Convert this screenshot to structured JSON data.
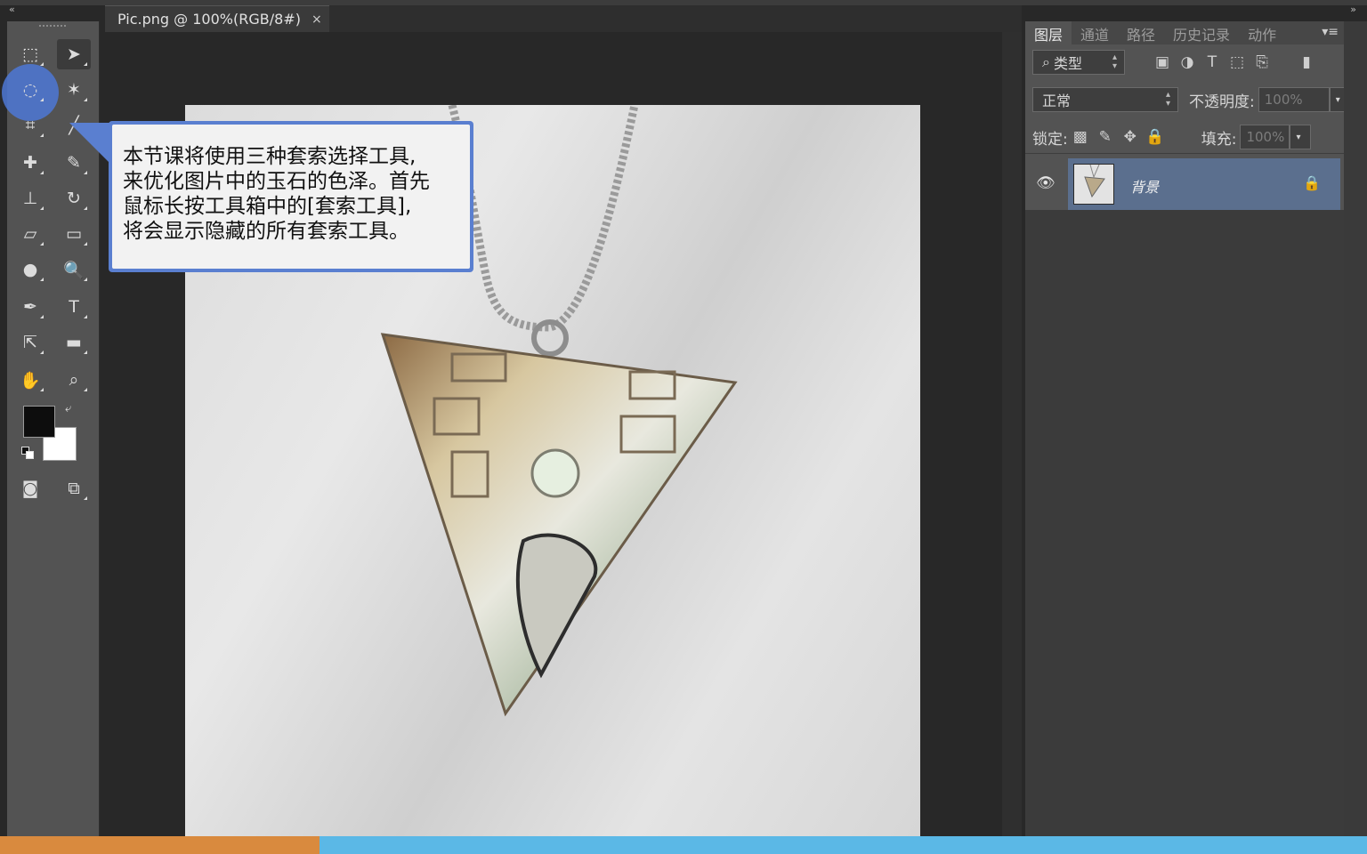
{
  "document": {
    "tab_title": "Pic.png @ 100%(RGB/8#)",
    "close_glyph": "×"
  },
  "callout": {
    "lines": [
      "本节课将使用三种套索选择工具,",
      "来优化图片中的玉石的色泽。首先",
      "鼠标长按工具箱中的[套索工具],",
      "将会显示隐藏的所有套索工具。"
    ]
  },
  "panel": {
    "tabs": [
      "图层",
      "通道",
      "路径",
      "历史记录",
      "动作"
    ],
    "filter_label": "类型",
    "blend_mode": "正常",
    "opacity_label": "不透明度:",
    "opacity_value": "100%",
    "lock_label": "锁定:",
    "fill_label": "填充:",
    "fill_value": "100%",
    "layer_name": "背景"
  },
  "tools": [
    {
      "name": "rectangular-marquee-icon",
      "glyph": "⬚"
    },
    {
      "name": "move-icon",
      "glyph": "➤"
    },
    {
      "name": "lasso-icon",
      "glyph": "◌"
    },
    {
      "name": "magic-wand-icon",
      "glyph": "✶"
    },
    {
      "name": "crop-icon",
      "glyph": "⌗"
    },
    {
      "name": "eyedropper-icon",
      "glyph": "╱"
    },
    {
      "name": "healing-brush-icon",
      "glyph": "✚"
    },
    {
      "name": "brush-icon",
      "glyph": "✎"
    },
    {
      "name": "clone-stamp-icon",
      "glyph": "⊥"
    },
    {
      "name": "history-brush-icon",
      "glyph": "↻"
    },
    {
      "name": "eraser-icon",
      "glyph": "▱"
    },
    {
      "name": "gradient-icon",
      "glyph": "▭"
    },
    {
      "name": "blur-icon",
      "glyph": "●"
    },
    {
      "name": "dodge-icon",
      "glyph": "🔍"
    },
    {
      "name": "pen-icon",
      "glyph": "✒"
    },
    {
      "name": "type-icon",
      "glyph": "T"
    },
    {
      "name": "path-selection-icon",
      "glyph": "⇱"
    },
    {
      "name": "rectangle-shape-icon",
      "glyph": "▬"
    },
    {
      "name": "hand-icon",
      "glyph": "✋"
    },
    {
      "name": "zoom-icon",
      "glyph": "⌕"
    }
  ],
  "colors": {
    "foreground": "#0d0d0d",
    "background": "#ffffff",
    "highlight": "#4e78d6",
    "layer_selected": "#5b6f8e"
  },
  "progress": {
    "fraction": 0.234
  }
}
